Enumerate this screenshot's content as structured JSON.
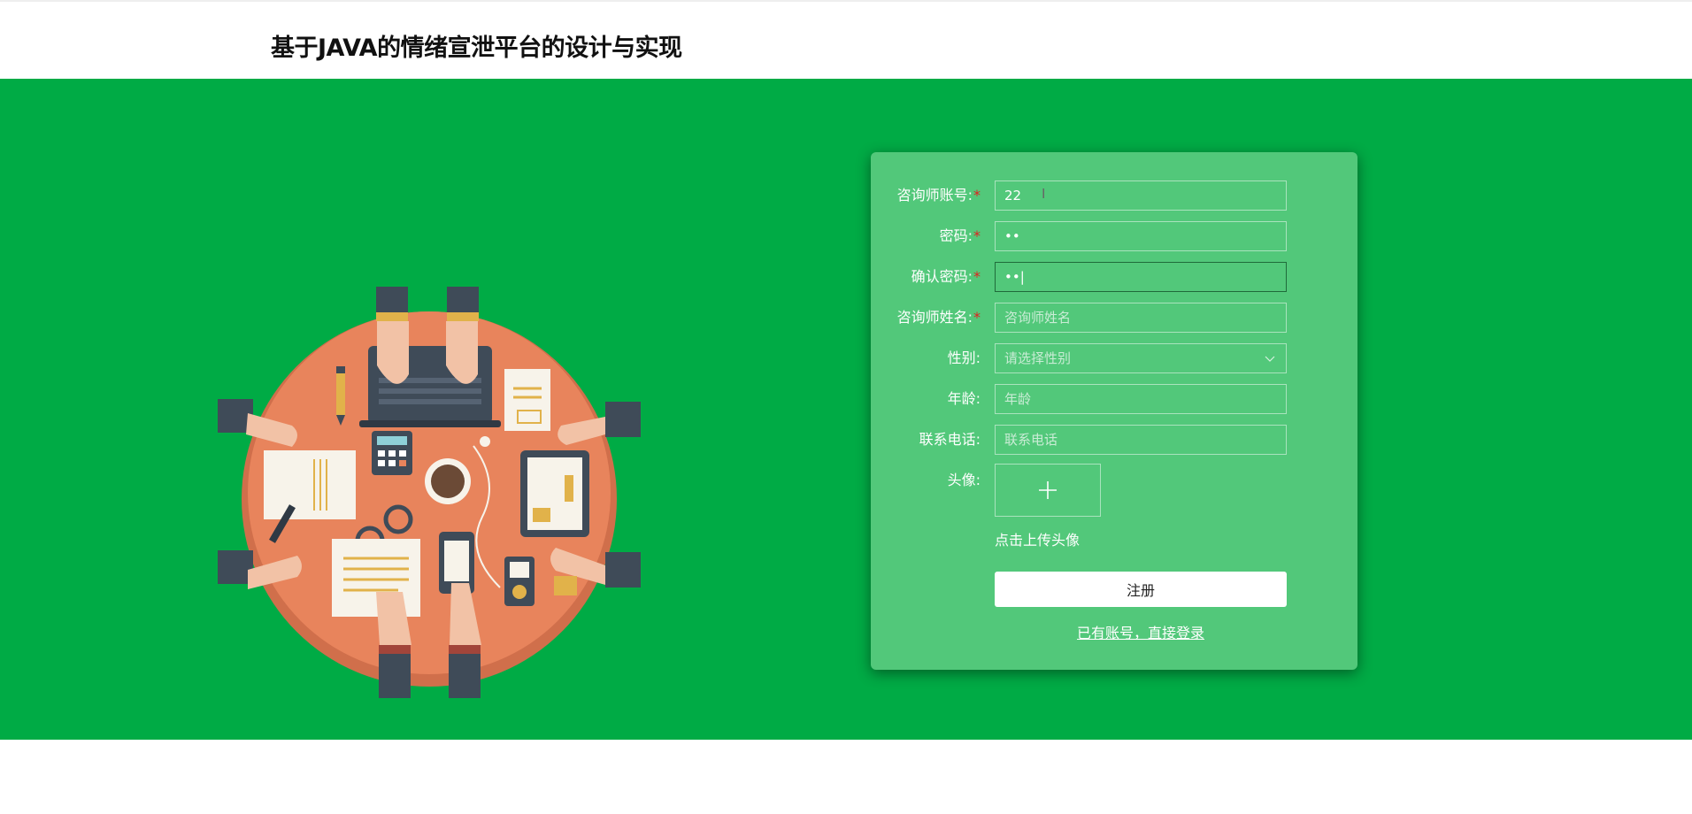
{
  "header": {
    "title": "基于JAVA的情绪宣泄平台的设计与实现"
  },
  "colors": {
    "brand_green": "#00ab45",
    "card_green": "#52c87a",
    "table_orange": "#e8845c",
    "required_star": "#e02020"
  },
  "form": {
    "account": {
      "label": "咨询师账号",
      "value": "22",
      "placeholder": "咨询师账号"
    },
    "password": {
      "label": "密码",
      "value": "••"
    },
    "confirm_password": {
      "label": "确认密码",
      "value": "••|"
    },
    "name": {
      "label": "咨询师姓名",
      "placeholder": "咨询师姓名"
    },
    "gender": {
      "label": "性别:",
      "placeholder": "请选择性别",
      "icon": "chevron-down-icon"
    },
    "age": {
      "label": "年龄:",
      "placeholder": "年龄"
    },
    "phone": {
      "label": "联系电话:",
      "placeholder": "联系电话"
    },
    "avatar": {
      "label": "头像:",
      "hint": "点击上传头像",
      "icon": "plus-icon"
    },
    "register_label": "注册",
    "login_link": "已有账号，直接登录"
  },
  "required_mark": "*",
  "colon": ":"
}
